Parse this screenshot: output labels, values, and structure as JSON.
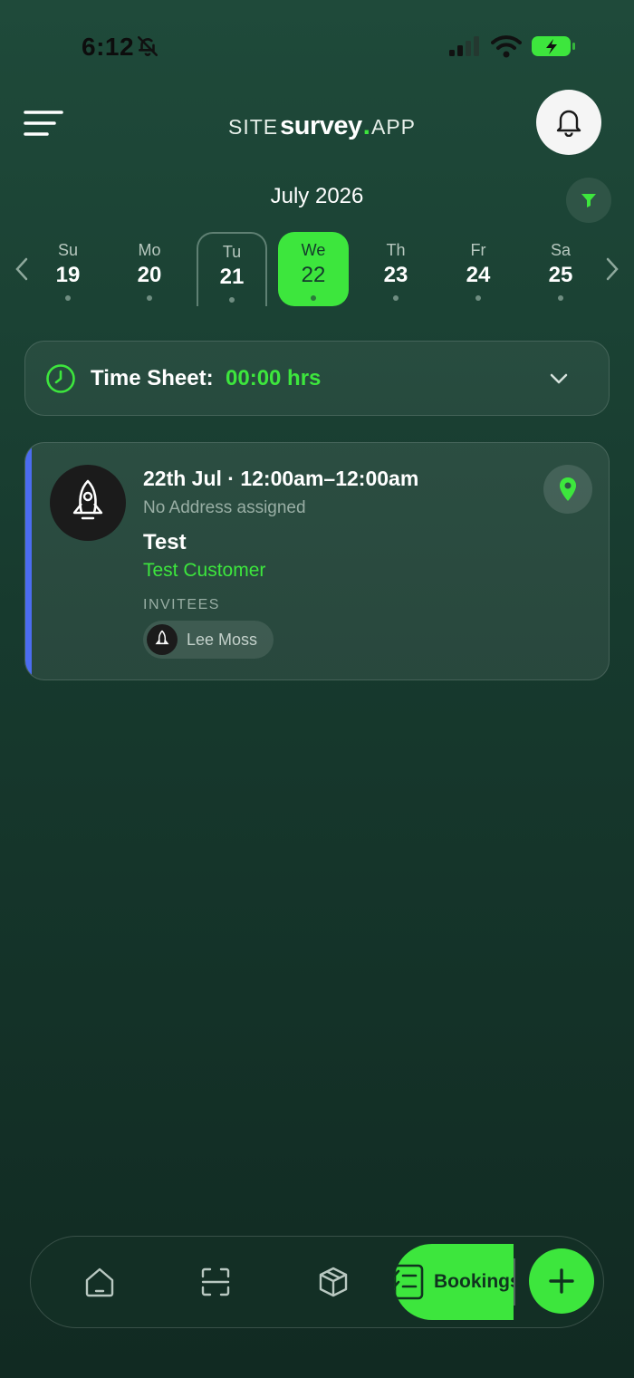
{
  "status_bar": {
    "time": "6:12"
  },
  "header": {
    "logo": {
      "site": "SITE",
      "survey": "survey",
      "dot": ".",
      "app": "APP"
    }
  },
  "calendar": {
    "month": "July 2026",
    "days": [
      {
        "name": "Su",
        "date": "19"
      },
      {
        "name": "Mo",
        "date": "20"
      },
      {
        "name": "Tu",
        "date": "21",
        "state": "today"
      },
      {
        "name": "We",
        "date": "22",
        "state": "selected"
      },
      {
        "name": "Th",
        "date": "23"
      },
      {
        "name": "Fr",
        "date": "24"
      },
      {
        "name": "Sa",
        "date": "25"
      }
    ]
  },
  "timesheet": {
    "label": "Time Sheet:",
    "value": "00:00 hrs"
  },
  "booking": {
    "when": "22th Jul · 12:00am–12:00am",
    "address": "No Address assigned",
    "title": "Test",
    "customer": "Test Customer",
    "invitees_label": "INVITEES",
    "invitees": [
      {
        "name": "Lee Moss"
      }
    ]
  },
  "bottom_nav": {
    "items": [
      {
        "name": "home",
        "icon": "home-icon"
      },
      {
        "name": "scan",
        "icon": "scan-icon"
      },
      {
        "name": "inventory",
        "icon": "box-icon"
      },
      {
        "name": "bookings",
        "icon": "checklist-icon",
        "label": "Bookings",
        "active": true
      }
    ],
    "fab_icon": "plus-icon"
  },
  "colors": {
    "accent": "#3de63d",
    "background": "#1f4a3a",
    "booking_bar": "#4b6cf0"
  }
}
